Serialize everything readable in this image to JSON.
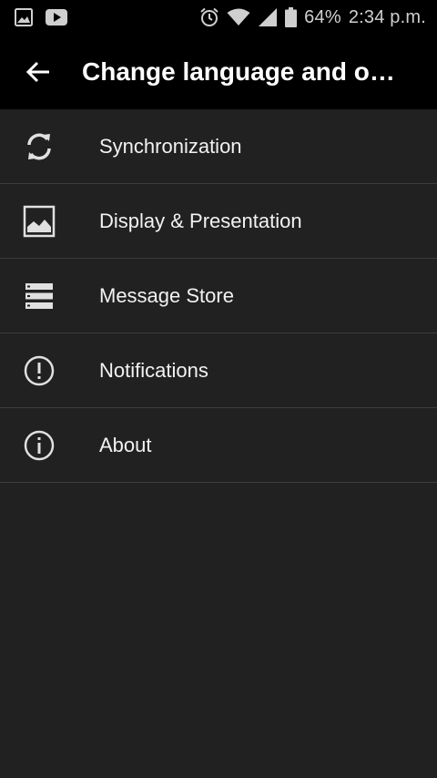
{
  "status_bar": {
    "left_icons": [
      "gallery-icon",
      "youtube-icon"
    ],
    "right_icons": [
      "alarm-icon",
      "wifi-icon",
      "signal-icon",
      "battery-icon"
    ],
    "battery_text": "64%",
    "time": "2:34 p.m."
  },
  "app_bar": {
    "back_icon": "arrow-back-icon",
    "title": "Change language and ot…"
  },
  "menu": {
    "items": [
      {
        "label": "Synchronization",
        "icon": "sync-icon"
      },
      {
        "label": "Display & Presentation",
        "icon": "image-icon"
      },
      {
        "label": "Message Store",
        "icon": "storage-icon"
      },
      {
        "label": "Notifications",
        "icon": "alert-circle-icon"
      },
      {
        "label": "About",
        "icon": "info-icon"
      }
    ]
  },
  "colors": {
    "background": "#212121",
    "bar": "#000000",
    "divider": "#3d3d3d",
    "text": "#f2f2f2"
  }
}
